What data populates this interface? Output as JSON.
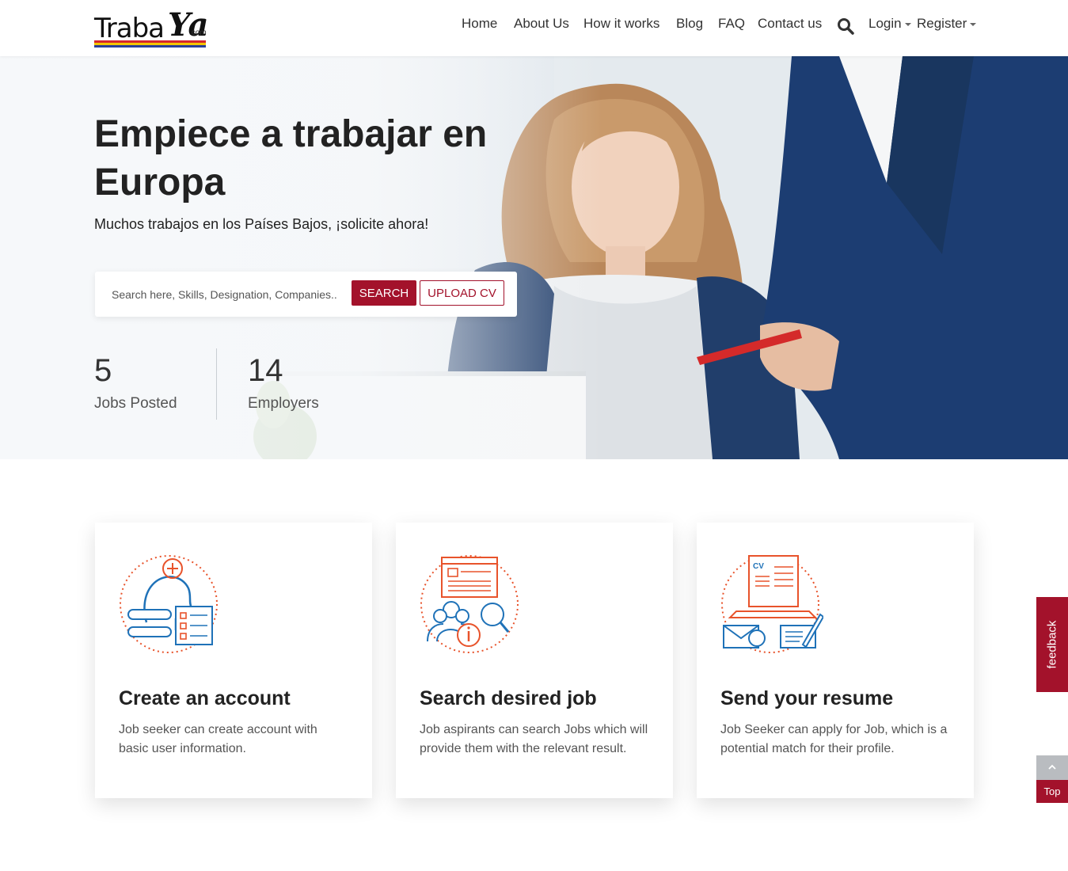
{
  "brand": {
    "logo_main": "Traba",
    "logo_accent": "Ya",
    "logo_suffix": ".com",
    "stripe_colors": [
      "#d8262b",
      "#f4c400",
      "#2a3f97"
    ]
  },
  "nav": {
    "items": [
      "Home",
      "About Us",
      "How it works",
      "Blog",
      "FAQ",
      "Contact us"
    ],
    "login": "Login",
    "register": "Register",
    "search_icon": "search-icon"
  },
  "hero": {
    "title": "Empiece a trabajar en Europa",
    "subtitle": "Muchos trabajos en los Países Bajos, ¡solicite ahora!",
    "search_placeholder": "Search here, Skills, Designation, Companies..",
    "search_button": "SEARCH",
    "upload_button": "UPLOAD CV",
    "stats": [
      {
        "value": "5",
        "label": "Jobs Posted"
      },
      {
        "value": "14",
        "label": "Employers"
      }
    ]
  },
  "steps": [
    {
      "icon": "account-profile-icon",
      "title": "Create an account",
      "text": "Job seeker can create account with basic user information."
    },
    {
      "icon": "job-search-icon",
      "title": "Search desired job",
      "text": "Job aspirants can search Jobs which will provide them with the relevant result."
    },
    {
      "icon": "resume-send-icon",
      "title": "Send your resume",
      "text": "Job Seeker can apply for Job, which is a potential match for their profile."
    }
  ],
  "widgets": {
    "feedback": "feedback",
    "top": "Top"
  },
  "colors": {
    "accent": "#a3122b",
    "icon_orange": "#e8532b",
    "icon_blue": "#1f72b8"
  }
}
